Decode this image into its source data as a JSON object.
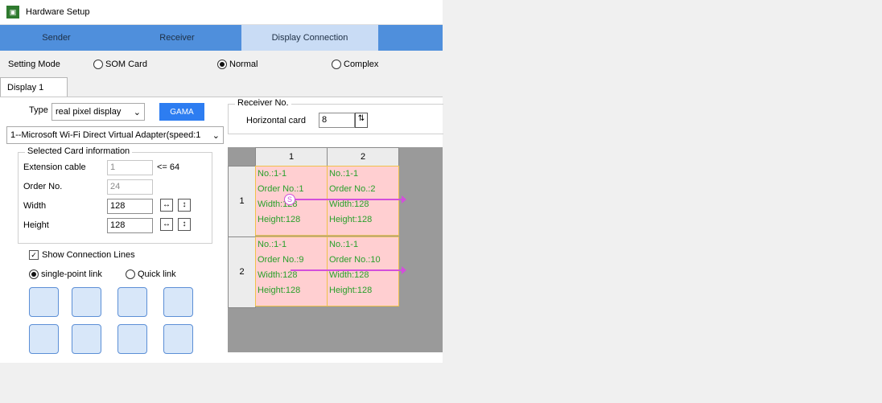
{
  "window": {
    "title": "Hardware Setup"
  },
  "tabs": [
    {
      "label": "Sender"
    },
    {
      "label": "Receiver"
    },
    {
      "label": "Display Connection"
    }
  ],
  "setting_mode": {
    "label": "Setting Mode",
    "options": [
      {
        "label": "SOM Card"
      },
      {
        "label": "Normal"
      },
      {
        "label": "Complex"
      }
    ]
  },
  "display_tab": {
    "label": "Display 1"
  },
  "left_panel": {
    "type_label": "Type",
    "type_value": "real pixel display",
    "gama_button": "GAMA",
    "adapter_value": "1--Microsoft Wi-Fi Direct Virtual Adapter(speed:1",
    "selected_card": {
      "title": "Selected Card information",
      "extension_label": "Extension cable",
      "extension_value": "1",
      "extension_hint": "<= 64",
      "order_label": "Order No.",
      "order_value": "24",
      "width_label": "Width",
      "width_value": "128",
      "height_label": "Height",
      "height_value": "128"
    },
    "show_lines": "Show Connection Lines",
    "single_point": "single-point link",
    "quick_link": "Quick link"
  },
  "receiver": {
    "title": "Receiver No.",
    "horizontal_label": "Horizontal card",
    "horizontal_value": "8"
  },
  "grid": {
    "columns": [
      "1",
      "2"
    ],
    "rows": [
      {
        "label": "1",
        "cells": [
          {
            "no": "No.:1-1",
            "order": "Order No.:1",
            "width": "Width:128",
            "height": "Height:128"
          },
          {
            "no": "No.:1-1",
            "order": "Order No.:2",
            "width": "Width:128",
            "height": "Height:128"
          }
        ]
      },
      {
        "label": "2",
        "cells": [
          {
            "no": "No.:1-1",
            "order": "Order No.:9",
            "width": "Width:128",
            "height": "Height:128"
          },
          {
            "no": "No.:1-1",
            "order": "Order No.:10",
            "width": "Width:128",
            "height": "Height:128"
          }
        ]
      }
    ],
    "start_marker": "S"
  }
}
